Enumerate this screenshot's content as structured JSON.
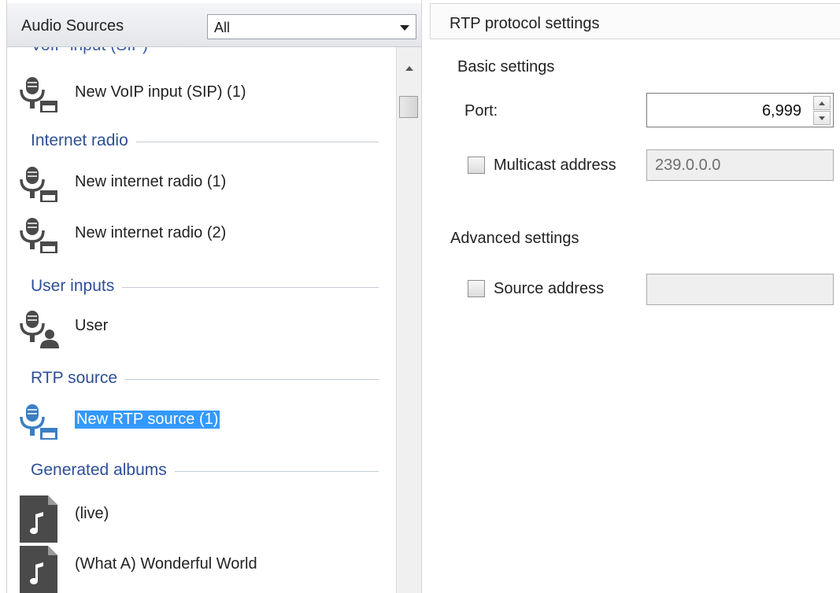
{
  "left_panel": {
    "title": "Audio Sources",
    "filter": {
      "value": "All",
      "icon": "chevron-down-icon"
    },
    "cut_off_group_text": "VoIP input (SIP)",
    "groups": [
      {
        "label": "Internet radio"
      },
      {
        "label": "User inputs"
      },
      {
        "label": "RTP source"
      },
      {
        "label": "Generated albums"
      }
    ],
    "items": [
      {
        "label": "New VoIP input (SIP) (1)",
        "icon": "microphone-device-icon"
      },
      {
        "label": "New internet radio (1)",
        "icon": "microphone-device-icon"
      },
      {
        "label": "New internet radio (2)",
        "icon": "microphone-device-icon"
      },
      {
        "label": "User",
        "icon": "microphone-user-icon"
      },
      {
        "label": "New RTP source (1)",
        "icon": "microphone-device-icon",
        "selected": true
      },
      {
        "label": "(live)",
        "icon": "music-file-icon"
      },
      {
        "label": "(What A) Wonderful World",
        "icon": "music-file-icon"
      }
    ]
  },
  "right_panel": {
    "title": "RTP protocol settings",
    "basic_settings": {
      "title": "Basic settings",
      "port_label": "Port:",
      "port_value": "6,999",
      "multicast_label": "Multicast address",
      "multicast_checked": false,
      "multicast_value": "239.0.0.0"
    },
    "advanced_settings": {
      "title": "Advanced settings",
      "source_label": "Source address",
      "source_checked": false,
      "source_value": ""
    }
  },
  "colors": {
    "group_text": "#2e4f96",
    "selection_bg": "#3399ff",
    "icon_gray": "#4a4a4a",
    "icon_selected": "#3a7fc4"
  }
}
